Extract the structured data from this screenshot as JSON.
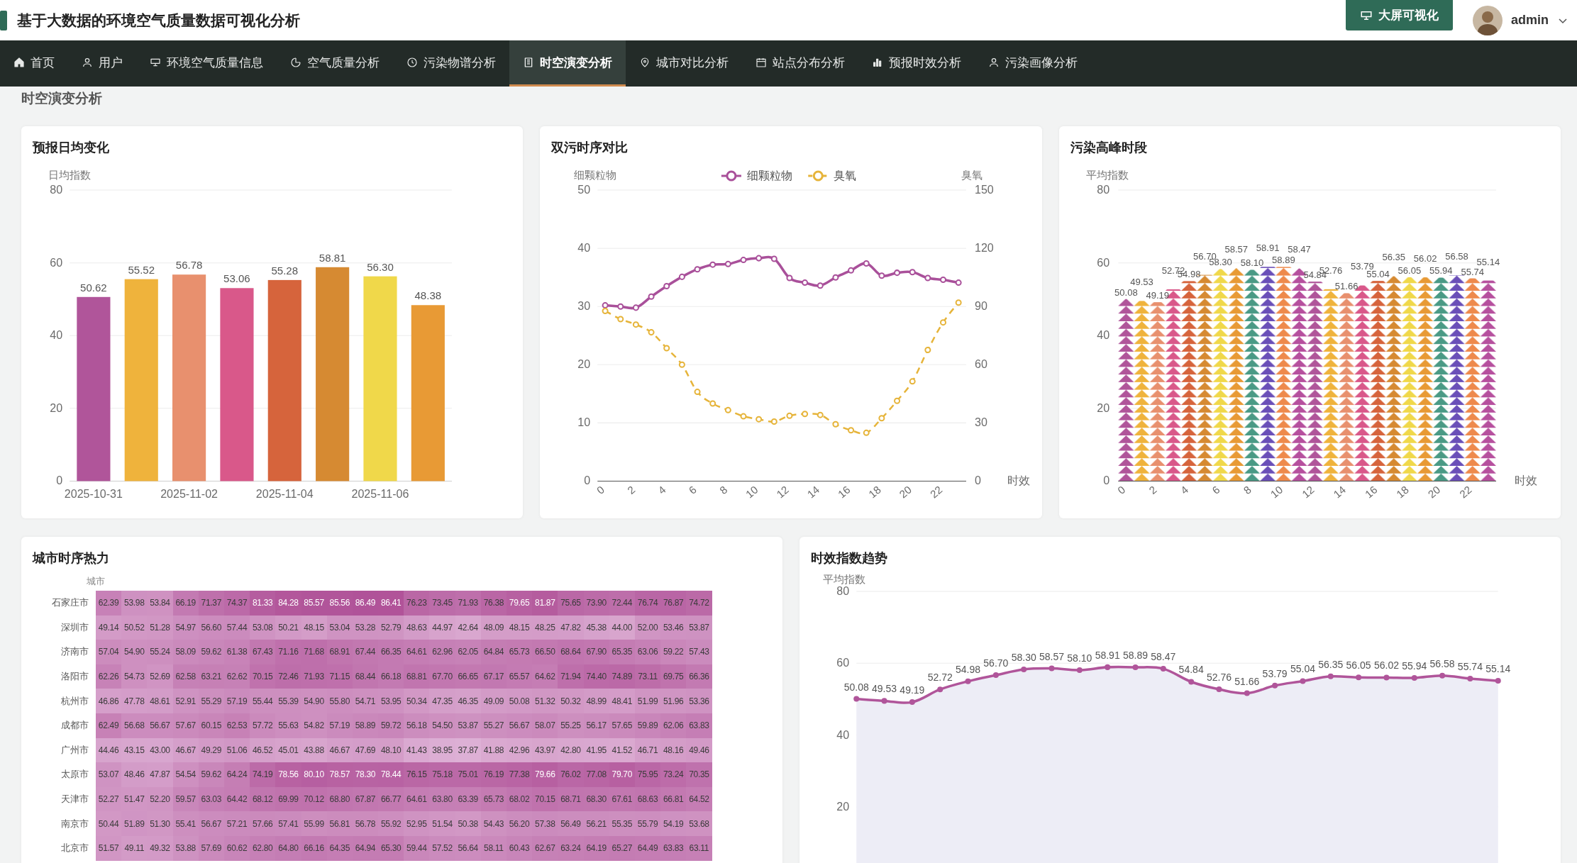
{
  "header": {
    "title": "基于大数据的环境空气质量数据可视化分析",
    "screen_button": "大屏可视化",
    "user": "admin"
  },
  "nav": [
    {
      "label": "首页",
      "selected": false
    },
    {
      "label": "用户",
      "selected": false
    },
    {
      "label": "环境空气质量信息",
      "selected": false
    },
    {
      "label": "空气质量分析",
      "selected": false
    },
    {
      "label": "污染物谱分析",
      "selected": false
    },
    {
      "label": "时空演变分析",
      "selected": true
    },
    {
      "label": "城市对比分析",
      "selected": false
    },
    {
      "label": "站点分布分析",
      "selected": false
    },
    {
      "label": "预报时效分析",
      "selected": false
    },
    {
      "label": "污染画像分析",
      "selected": false
    }
  ],
  "page_title": "时空演变分析",
  "daily_forecast": {
    "title": "预报日均变化",
    "chart_data": {
      "type": "bar",
      "ylabel": "日均指数",
      "values": [
        50.62,
        55.52,
        56.78,
        53.06,
        55.28,
        58.81,
        56.3,
        48.38
      ],
      "value_labels": [
        "50.62",
        "55.52",
        "56.78",
        "53.06",
        "55.28",
        "58.81",
        "56.30",
        "48.38"
      ],
      "categories": [
        "2025-10-31",
        null,
        "2025-11-02",
        null,
        "2025-11-04",
        null,
        "2025-11-06",
        null
      ],
      "ylim": [
        0,
        80
      ],
      "yticks": [
        0,
        20,
        40,
        60,
        80
      ],
      "grid": true
    }
  },
  "dual_series": {
    "title": "双污时序对比",
    "chart_data": {
      "type": "line",
      "xlabel": "时效",
      "ylabel": "细颗粒物",
      "y2label": "臭氧",
      "x": [
        0,
        1,
        2,
        3,
        4,
        5,
        6,
        7,
        8,
        9,
        10,
        11,
        12,
        13,
        14,
        15,
        16,
        17,
        18,
        19,
        20,
        21,
        22,
        23
      ],
      "xlim": [
        -0.5,
        23.5
      ],
      "xticks": [
        0,
        2,
        4,
        6,
        8,
        10,
        12,
        14,
        16,
        18,
        20,
        22
      ],
      "ylim": [
        0,
        50
      ],
      "yticks": [
        0,
        10,
        20,
        30,
        40,
        50
      ],
      "y2lim": [
        0,
        150
      ],
      "y2ticks": [
        0,
        30,
        60,
        90,
        120,
        150
      ],
      "grid": true,
      "legend": true,
      "series": [
        {
          "name": "细颗粒物",
          "color": "#a9509a",
          "axis": "y",
          "line_style": "solid",
          "marker": "circle",
          "values": [
            30.2,
            30.0,
            29.8,
            31.7,
            33.5,
            35.1,
            36.4,
            37.2,
            37.3,
            38.0,
            38.3,
            38.2,
            34.9,
            34.1,
            33.6,
            35.0,
            36.2,
            37.4,
            35.3,
            35.8,
            35.9,
            34.9,
            34.6,
            34.1
          ]
        },
        {
          "name": "臭氧",
          "color": "#e6b43a",
          "axis": "y2",
          "line_style": "dashed",
          "marker": "circle",
          "values": [
            87.7,
            83.5,
            80.7,
            76.7,
            68.5,
            60.0,
            46.0,
            40.0,
            36.6,
            33.4,
            31.9,
            30.7,
            33.7,
            34.6,
            34.1,
            29.3,
            26.2,
            24.9,
            32.4,
            41.4,
            51.4,
            67.6,
            81.8,
            92.0
          ]
        }
      ]
    }
  },
  "peak_hours": {
    "title": "污染高峰时段",
    "chart_data": {
      "type": "bar",
      "xlabel": "时效",
      "ylabel": "平均指数",
      "x": [
        0,
        1,
        2,
        3,
        4,
        5,
        6,
        7,
        8,
        9,
        10,
        11,
        12,
        13,
        14,
        15,
        16,
        17,
        18,
        19,
        20,
        21,
        22,
        23
      ],
      "xlim": [
        -0.5,
        23.5
      ],
      "xticks": [
        0,
        2,
        4,
        6,
        8,
        10,
        12,
        14,
        16,
        18,
        20,
        22
      ],
      "ylim": [
        0,
        80
      ],
      "yticks": [
        0,
        20,
        40,
        60,
        80
      ],
      "grid": true,
      "values": [
        50.08,
        49.53,
        49.19,
        52.72,
        54.98,
        56.7,
        58.3,
        58.57,
        58.1,
        58.91,
        58.89,
        58.47,
        54.84,
        52.76,
        51.66,
        53.79,
        55.04,
        56.35,
        56.05,
        56.02,
        55.94,
        56.58,
        55.74,
        55.14
      ],
      "value_labels": [
        "50.08",
        "49.53",
        "49.19",
        "52.72",
        "54.98",
        "56.70",
        "58.30",
        "58.57",
        "58.10",
        "58.91",
        "58.89",
        "58.47",
        "54.84",
        "52.76",
        "51.66",
        "53.79",
        "55.04",
        "56.35",
        "56.05",
        "56.02",
        "55.94",
        "56.58",
        "55.74",
        "55.14"
      ]
    }
  },
  "heatmap": {
    "title": "城市时序热力",
    "ylabel": "城市",
    "rows": [
      {
        "city": "石家庄市",
        "values": [
          "62.39",
          "53.98",
          "53.84",
          "66.19",
          "71.37",
          "74.37",
          "81.33",
          "84.28",
          "85.57",
          "85.56",
          "86.49",
          "86.41",
          "76.23",
          "73.45",
          "71.93",
          "76.38",
          "79.65",
          "81.87",
          "75.65",
          "73.90",
          "72.44",
          "76.74",
          "76.87",
          "74.72"
        ]
      },
      {
        "city": "深圳市",
        "values": [
          "49.14",
          "50.52",
          "51.28",
          "54.97",
          "56.60",
          "57.44",
          "53.08",
          "50.21",
          "48.15",
          "53.04",
          "53.28",
          "52.79",
          "48.63",
          "44.97",
          "42.64",
          "48.09",
          "48.15",
          "48.25",
          "47.82",
          "45.38",
          "44.00",
          "52.00",
          "53.46",
          "53.87"
        ]
      },
      {
        "city": "济南市",
        "values": [
          "57.04",
          "54.90",
          "55.24",
          "58.09",
          "59.62",
          "61.38",
          "67.43",
          "71.16",
          "71.68",
          "68.91",
          "67.44",
          "66.35",
          "64.61",
          "62.96",
          "62.05",
          "64.84",
          "65.73",
          "66.50",
          "68.64",
          "67.90",
          "65.35",
          "63.06",
          "59.22",
          "57.43"
        ]
      },
      {
        "city": "洛阳市",
        "values": [
          "62.26",
          "54.73",
          "52.69",
          "62.58",
          "63.21",
          "62.62",
          "70.15",
          "72.46",
          "71.93",
          "71.15",
          "68.44",
          "66.18",
          "68.81",
          "67.70",
          "66.65",
          "67.17",
          "65.57",
          "64.62",
          "71.94",
          "74.40",
          "74.89",
          "73.11",
          "69.75",
          "66.36"
        ]
      },
      {
        "city": "杭州市",
        "values": [
          "46.86",
          "47.78",
          "48.61",
          "52.91",
          "55.29",
          "57.19",
          "55.44",
          "55.39",
          "54.90",
          "55.80",
          "54.71",
          "53.95",
          "50.34",
          "47.35",
          "46.35",
          "49.09",
          "50.08",
          "51.32",
          "50.32",
          "48.99",
          "48.41",
          "51.99",
          "51.96",
          "53.36"
        ]
      },
      {
        "city": "成都市",
        "values": [
          "62.49",
          "56.68",
          "56.67",
          "57.67",
          "60.15",
          "62.53",
          "57.72",
          "55.63",
          "54.82",
          "57.19",
          "58.89",
          "59.72",
          "56.18",
          "54.50",
          "53.87",
          "55.27",
          "56.67",
          "58.07",
          "55.25",
          "56.17",
          "57.65",
          "59.89",
          "62.06",
          "63.83"
        ]
      },
      {
        "city": "广州市",
        "values": [
          "44.46",
          "43.15",
          "43.00",
          "46.67",
          "49.29",
          "51.06",
          "46.52",
          "45.01",
          "43.88",
          "46.67",
          "47.69",
          "48.10",
          "41.43",
          "38.95",
          "37.87",
          "41.88",
          "42.96",
          "43.97",
          "42.80",
          "41.95",
          "41.52",
          "46.71",
          "48.16",
          "49.46"
        ]
      },
      {
        "city": "太原市",
        "values": [
          "53.07",
          "48.46",
          "47.87",
          "54.54",
          "59.62",
          "64.24",
          "74.19",
          "78.56",
          "80.10",
          "78.57",
          "78.30",
          "78.44",
          "76.15",
          "75.18",
          "75.01",
          "76.19",
          "77.38",
          "79.66",
          "76.02",
          "77.08",
          "79.70",
          "75.95",
          "73.24",
          "70.35"
        ]
      },
      {
        "city": "天津市",
        "values": [
          "52.27",
          "51.47",
          "52.20",
          "59.57",
          "63.03",
          "64.42",
          "68.12",
          "69.99",
          "70.12",
          "68.80",
          "67.87",
          "66.77",
          "64.61",
          "63.80",
          "63.39",
          "65.73",
          "68.02",
          "70.15",
          "68.71",
          "68.30",
          "67.61",
          "68.63",
          "66.81",
          "64.52"
        ]
      },
      {
        "city": "南京市",
        "values": [
          "50.44",
          "51.89",
          "51.30",
          "55.41",
          "56.67",
          "57.21",
          "57.66",
          "57.41",
          "55.99",
          "56.81",
          "56.78",
          "55.92",
          "52.95",
          "51.54",
          "50.38",
          "54.43",
          "56.20",
          "57.38",
          "56.49",
          "56.21",
          "55.35",
          "55.79",
          "54.19",
          "53.68"
        ]
      },
      {
        "city": "北京市",
        "values": [
          "51.57",
          "49.11",
          "49.32",
          "53.88",
          "57.69",
          "60.62",
          "62.80",
          "64.80",
          "66.16",
          "64.35",
          "64.94",
          "65.30",
          "59.44",
          "57.52",
          "56.64",
          "58.11",
          "60.43",
          "62.67",
          "63.24",
          "64.19",
          "65.27",
          "64.49",
          "63.83",
          "63.11"
        ]
      }
    ]
  },
  "trend": {
    "title": "时效指数趋势",
    "chart_data": {
      "type": "area",
      "ylabel": "平均指数",
      "grid": true,
      "ylim": [
        0,
        80
      ],
      "yticks": [
        20,
        40,
        60,
        80
      ],
      "values": [
        50.08,
        49.53,
        49.19,
        52.72,
        54.98,
        56.7,
        58.3,
        58.57,
        58.1,
        58.91,
        58.89,
        58.47,
        54.84,
        52.76,
        51.66,
        53.79,
        55.04,
        56.35,
        56.05,
        56.02,
        55.94,
        56.58,
        55.74,
        55.14
      ],
      "value_labels": [
        "50.08",
        "49.53",
        "49.19",
        "52.72",
        "54.98",
        "56.70",
        "58.30",
        "58.57",
        "58.10",
        "58.91",
        "58.89",
        "58.47",
        "54.84",
        "52.76",
        "51.66",
        "53.79",
        "55.04",
        "56.35",
        "56.05",
        "56.02",
        "55.94",
        "56.58",
        "55.74",
        "55.14"
      ]
    }
  }
}
